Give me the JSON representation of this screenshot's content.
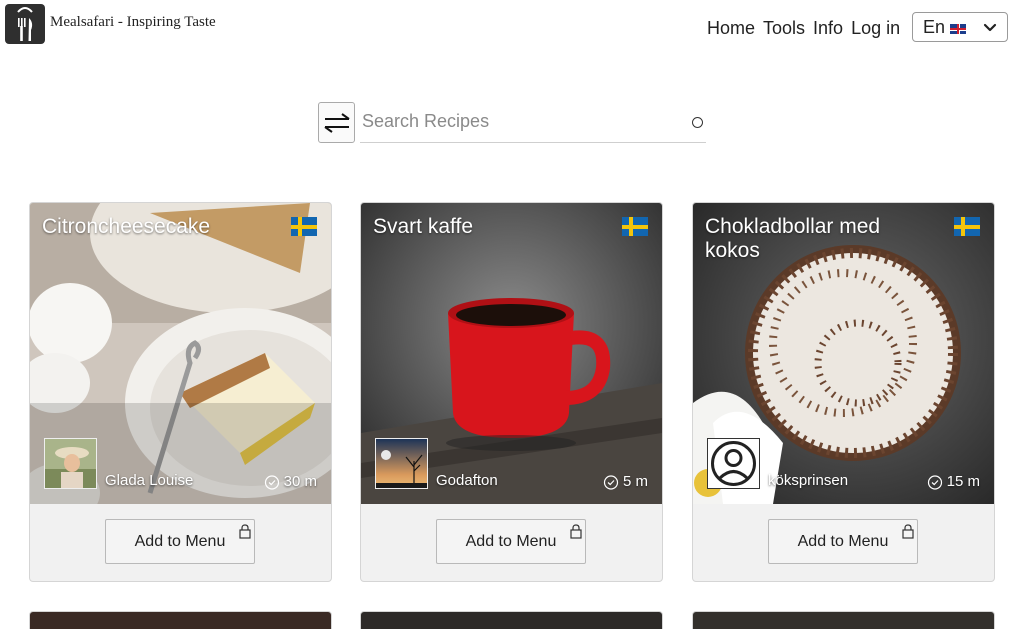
{
  "brand": {
    "name": "Mealsafari - Inspiring Taste"
  },
  "nav": {
    "home": "Home",
    "tools": "Tools",
    "info": "Info",
    "login": "Log in",
    "language": "En"
  },
  "search": {
    "placeholder": "Search Recipes"
  },
  "cards": [
    {
      "title": "Citroncheesecake",
      "author": "Glada Louise",
      "time": "30 m",
      "button": "Add to Menu",
      "flag": "sweden-flag-icon"
    },
    {
      "title": "Svart kaffe",
      "author": "Godafton",
      "time": "5 m",
      "button": "Add to Menu",
      "flag": "sweden-flag-icon"
    },
    {
      "title": "Chokladbollar med kokos",
      "author": "köksprinsen",
      "time": "15 m",
      "button": "Add to Menu",
      "flag": "sweden-flag-icon"
    }
  ],
  "icons": {
    "logo": "fork-knife-bag-icon",
    "filter": "swap-arrows-icon",
    "spinner": "loading-icon",
    "clock": "clock-check-icon",
    "lock": "lock-icon",
    "language_chevron": "chevron-down-icon"
  },
  "colors": {
    "logo_bg": "#2f2f2f",
    "card_bg": "#f1f1f1",
    "sweden_blue": "#1266b0",
    "sweden_yellow": "#f2c40c"
  }
}
